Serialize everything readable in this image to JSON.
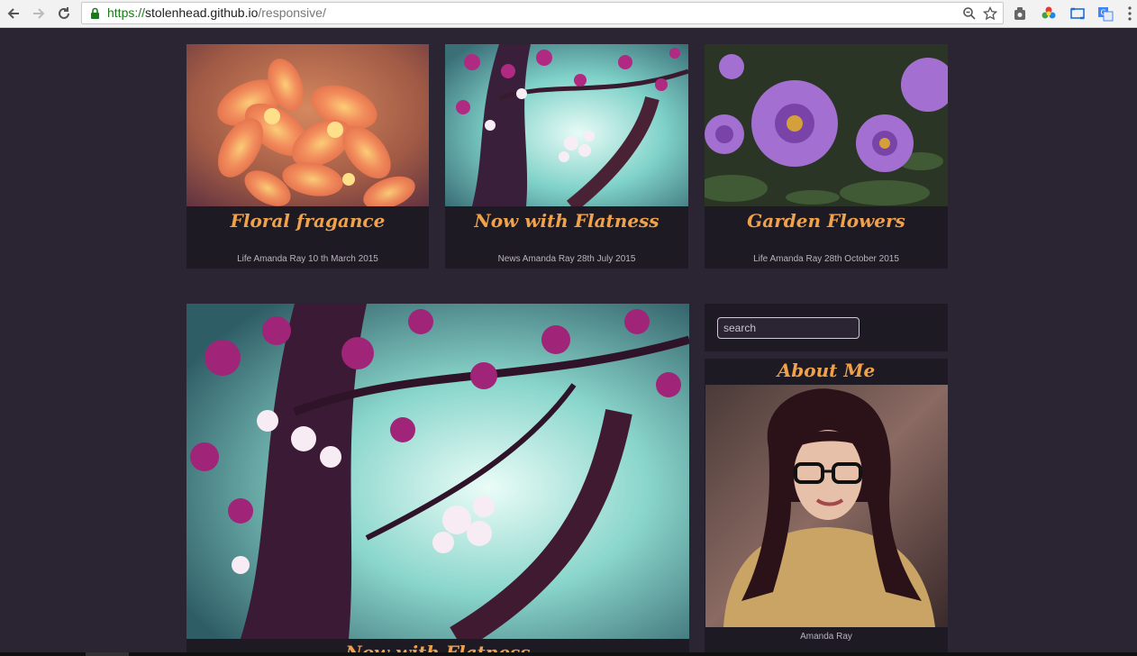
{
  "browser": {
    "url_scheme": "https://",
    "url_host": "stolenhead.github.io",
    "url_path": "/responsive/",
    "icons": [
      "back-icon",
      "forward-icon",
      "reload-icon",
      "lock-icon",
      "zoom-icon",
      "bookmark-star-icon",
      "extension-icon",
      "color-picker-icon",
      "screenshot-icon",
      "translate-icon",
      "menu-icon"
    ]
  },
  "cards": [
    {
      "title": "Floral fragance",
      "meta": "Life Amanda Ray 10 th March 2015",
      "image": "orange-flowers"
    },
    {
      "title": "Now with Flatness",
      "meta": "News Amanda Ray 28th July 2015",
      "image": "cherry-blossom"
    },
    {
      "title": "Garden Flowers",
      "meta": "Life Amanda Ray 28th October 2015",
      "image": "purple-petunias"
    }
  ],
  "feature": {
    "title": "Now with Flatness",
    "image": "cherry-blossom-large"
  },
  "sidebar": {
    "search_placeholder": "search",
    "about_heading": "About Me",
    "about_caption": "Amanda Ray",
    "about_image": "woman-with-glasses"
  },
  "colors": {
    "page_bg": "#2b2433",
    "card_bg": "#1e1a24",
    "accent": "#f0a24a",
    "meta_text": "#b8b3be"
  }
}
